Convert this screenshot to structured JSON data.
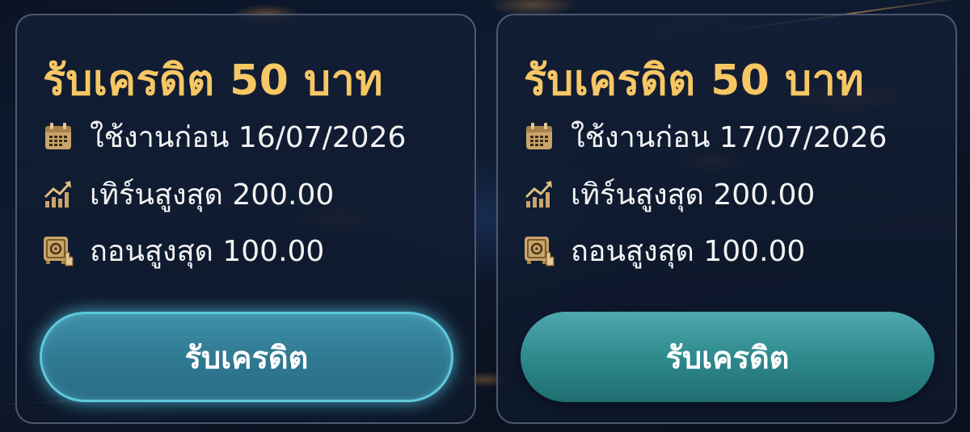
{
  "colors": {
    "title_gold": "#f6c764",
    "icon_gold": "#c9a56a",
    "button_teal": "#2f8a8e",
    "button_glow": "#5ec8dc",
    "text_white": "#f2f2f2"
  },
  "offers": [
    {
      "title": "รับเครดิต 50 บาท",
      "use_before": "ใช้งานก่อน 16/07/2026",
      "max_turnover": "เทิร์นสูงสุด 200.00",
      "max_withdraw": "ถอนสูงสุด 100.00",
      "button_label": "รับเครดิต",
      "icons": [
        "calendar-icon",
        "growth-chart-icon",
        "safe-icon"
      ]
    },
    {
      "title": "รับเครดิต 50 บาท",
      "use_before": "ใช้งานก่อน 17/07/2026",
      "max_turnover": "เทิร์นสูงสุด 200.00",
      "max_withdraw": "ถอนสูงสุด 100.00",
      "button_label": "รับเครดิต",
      "icons": [
        "calendar-icon",
        "growth-chart-icon",
        "safe-icon"
      ]
    }
  ]
}
